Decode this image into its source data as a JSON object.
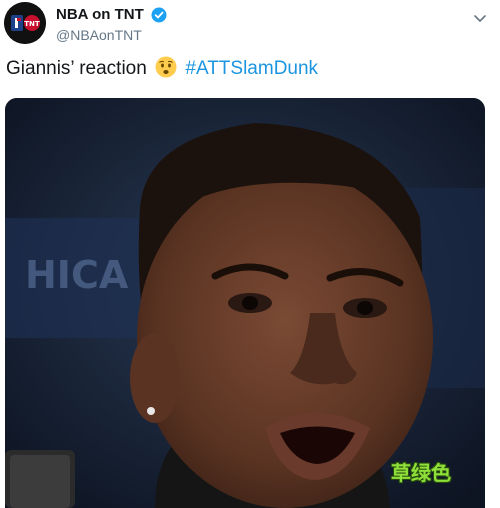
{
  "author": {
    "display_name": "NBA on TNT",
    "handle": "@NBAonTNT",
    "avatar_icon": "nba-tnt-logo",
    "verified": true
  },
  "tweet": {
    "text": "Giannis’ reaction",
    "emoji": "worried-face",
    "hashtag": "#ATTSlamDunk"
  },
  "media": {
    "type": "video-still",
    "background_sign_text": "HICA",
    "watermark": "草绿色"
  },
  "colors": {
    "hashtag": "#1b95e0",
    "verified": "#1da1f2",
    "watermark": "#8fe13a"
  }
}
